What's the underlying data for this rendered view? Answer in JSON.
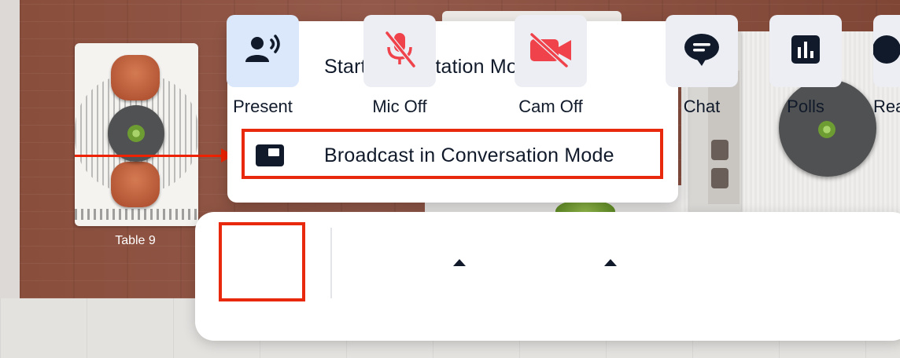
{
  "background": {
    "table_label": "Table 9"
  },
  "menu": {
    "items": [
      {
        "label": "Start Presentation Mode",
        "icon": "presenter-screen-icon"
      },
      {
        "label": "Broadcast in Conversation Mode",
        "icon": "broadcast-window-icon"
      }
    ],
    "highlighted_index": 1
  },
  "toolbar": {
    "buttons": [
      {
        "label": "Present",
        "icon": "present-speaker-icon",
        "state": "active"
      },
      {
        "label": "Mic Off",
        "icon": "mic-off-icon",
        "state": "off",
        "has_dropdown": true
      },
      {
        "label": "Cam Off",
        "icon": "camera-off-icon",
        "state": "off",
        "has_dropdown": true
      },
      {
        "label": "Chat",
        "icon": "chat-icon"
      },
      {
        "label": "Polls",
        "icon": "polls-icon"
      },
      {
        "label": "Rea",
        "icon": "reactions-icon"
      }
    ]
  },
  "colors": {
    "highlight": "#e8290e",
    "icon_dark": "#101a2a",
    "off_red": "#f0424b",
    "present_tile": "#dbe8fb"
  }
}
